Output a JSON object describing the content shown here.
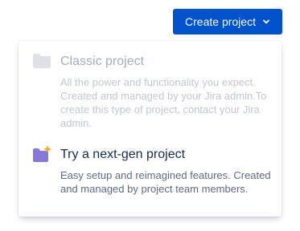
{
  "header": {
    "create_button_label": "Create project"
  },
  "menu": {
    "items": [
      {
        "title": "Classic project",
        "description": "All the power and functionality you expect. Created and managed by your Jira admin.To create this type of project, contact your Jira admin.",
        "icon": "folder-icon",
        "disabled": true
      },
      {
        "title": "Try a next-gen project",
        "description": "Easy setup and reimagined features. Created and managed by project team members.",
        "icon": "sparkle-folder-icon",
        "disabled": false
      }
    ]
  },
  "colors": {
    "primary_button": "#0052cc",
    "next_gen_folder": "#8777d9",
    "sparkle": "#ffab00",
    "disabled_folder": "#dfe1e6"
  }
}
